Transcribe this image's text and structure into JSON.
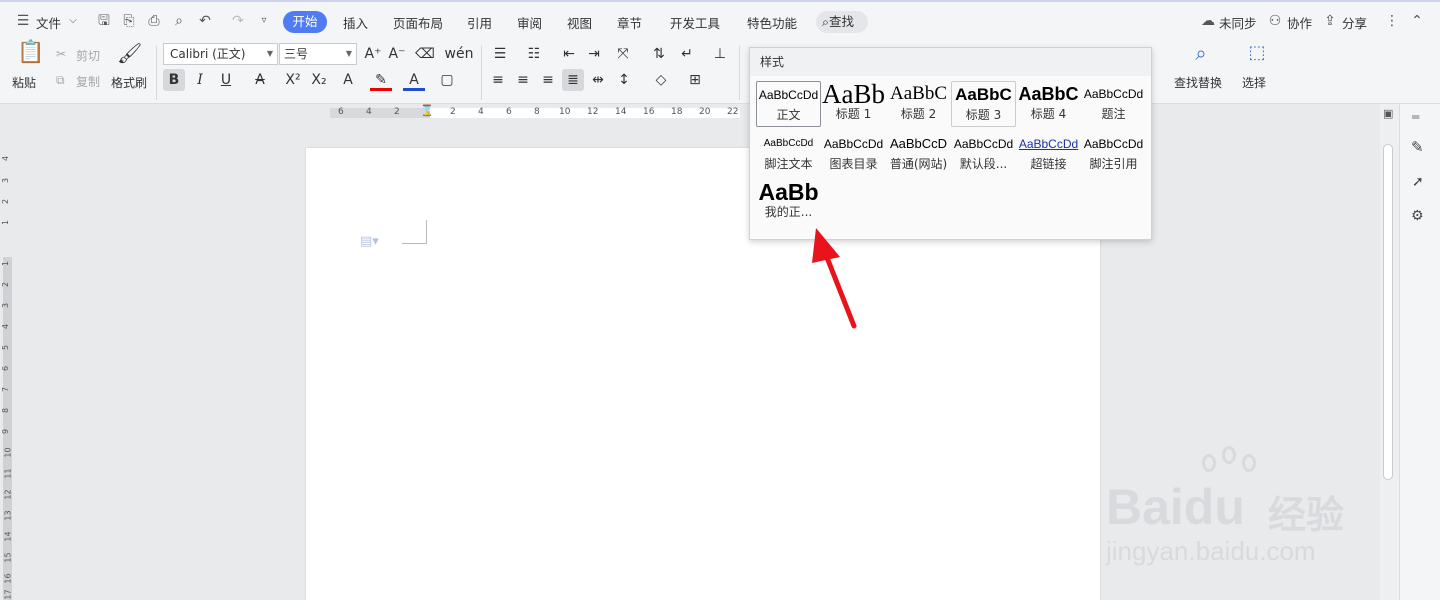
{
  "menubar": {
    "file": "文件",
    "tabs": [
      "开始",
      "插入",
      "页面布局",
      "引用",
      "审阅",
      "视图",
      "章节",
      "开发工具",
      "特色功能"
    ],
    "search": "查找",
    "unsynced": "未同步",
    "collab": "协作",
    "share": "分享"
  },
  "ribbon": {
    "paste": "粘贴",
    "cut": "剪切",
    "copy": "复制",
    "format_painter": "格式刷",
    "font_name": "Calibri (正文)",
    "font_size": "三号",
    "find_replace": "查找替换",
    "select": "选择"
  },
  "ruler": {
    "h_left": [
      "6",
      "4",
      "2"
    ],
    "h_right": [
      "2",
      "4",
      "6",
      "8",
      "10",
      "12",
      "14",
      "16",
      "18",
      "20",
      "22"
    ],
    "v_top": [
      "4",
      "3",
      "2",
      "1"
    ],
    "v_bottom": [
      "1",
      "2",
      "3",
      "4",
      "5",
      "6",
      "7",
      "8",
      "9",
      "10",
      "11",
      "12",
      "13",
      "14",
      "15",
      "16",
      "17"
    ]
  },
  "styles_popup": {
    "title": "样式",
    "items": [
      {
        "preview": "AaBbCcDd",
        "label": "正文"
      },
      {
        "preview": "AaBb",
        "label": "标题 1"
      },
      {
        "preview": "AaBbC",
        "label": "标题 2"
      },
      {
        "preview": "AaBbC",
        "label": "标题 3"
      },
      {
        "preview": "AaBbC",
        "label": "标题 4"
      },
      {
        "preview": "AaBbCcDd",
        "label": "题注"
      },
      {
        "preview": "AaBbCcDd",
        "label": "脚注文本"
      },
      {
        "preview": "AaBbCcDd",
        "label": "图表目录"
      },
      {
        "preview": "AaBbCcD",
        "label": "普通(网站)"
      },
      {
        "preview": "AaBbCcDd",
        "label": "默认段..."
      },
      {
        "preview": "AaBbCcDd",
        "label": "超链接"
      },
      {
        "preview": "AaBbCcDd",
        "label": "脚注引用"
      },
      {
        "preview": "AaBb",
        "label": "我的正..."
      }
    ]
  },
  "watermark": {
    "brand": "Baidu",
    "brand_cn": "经验",
    "url": "jingyan.baidu.com"
  },
  "colors": {
    "accent": "#4f7cf3",
    "arrow": "#e8131b"
  }
}
